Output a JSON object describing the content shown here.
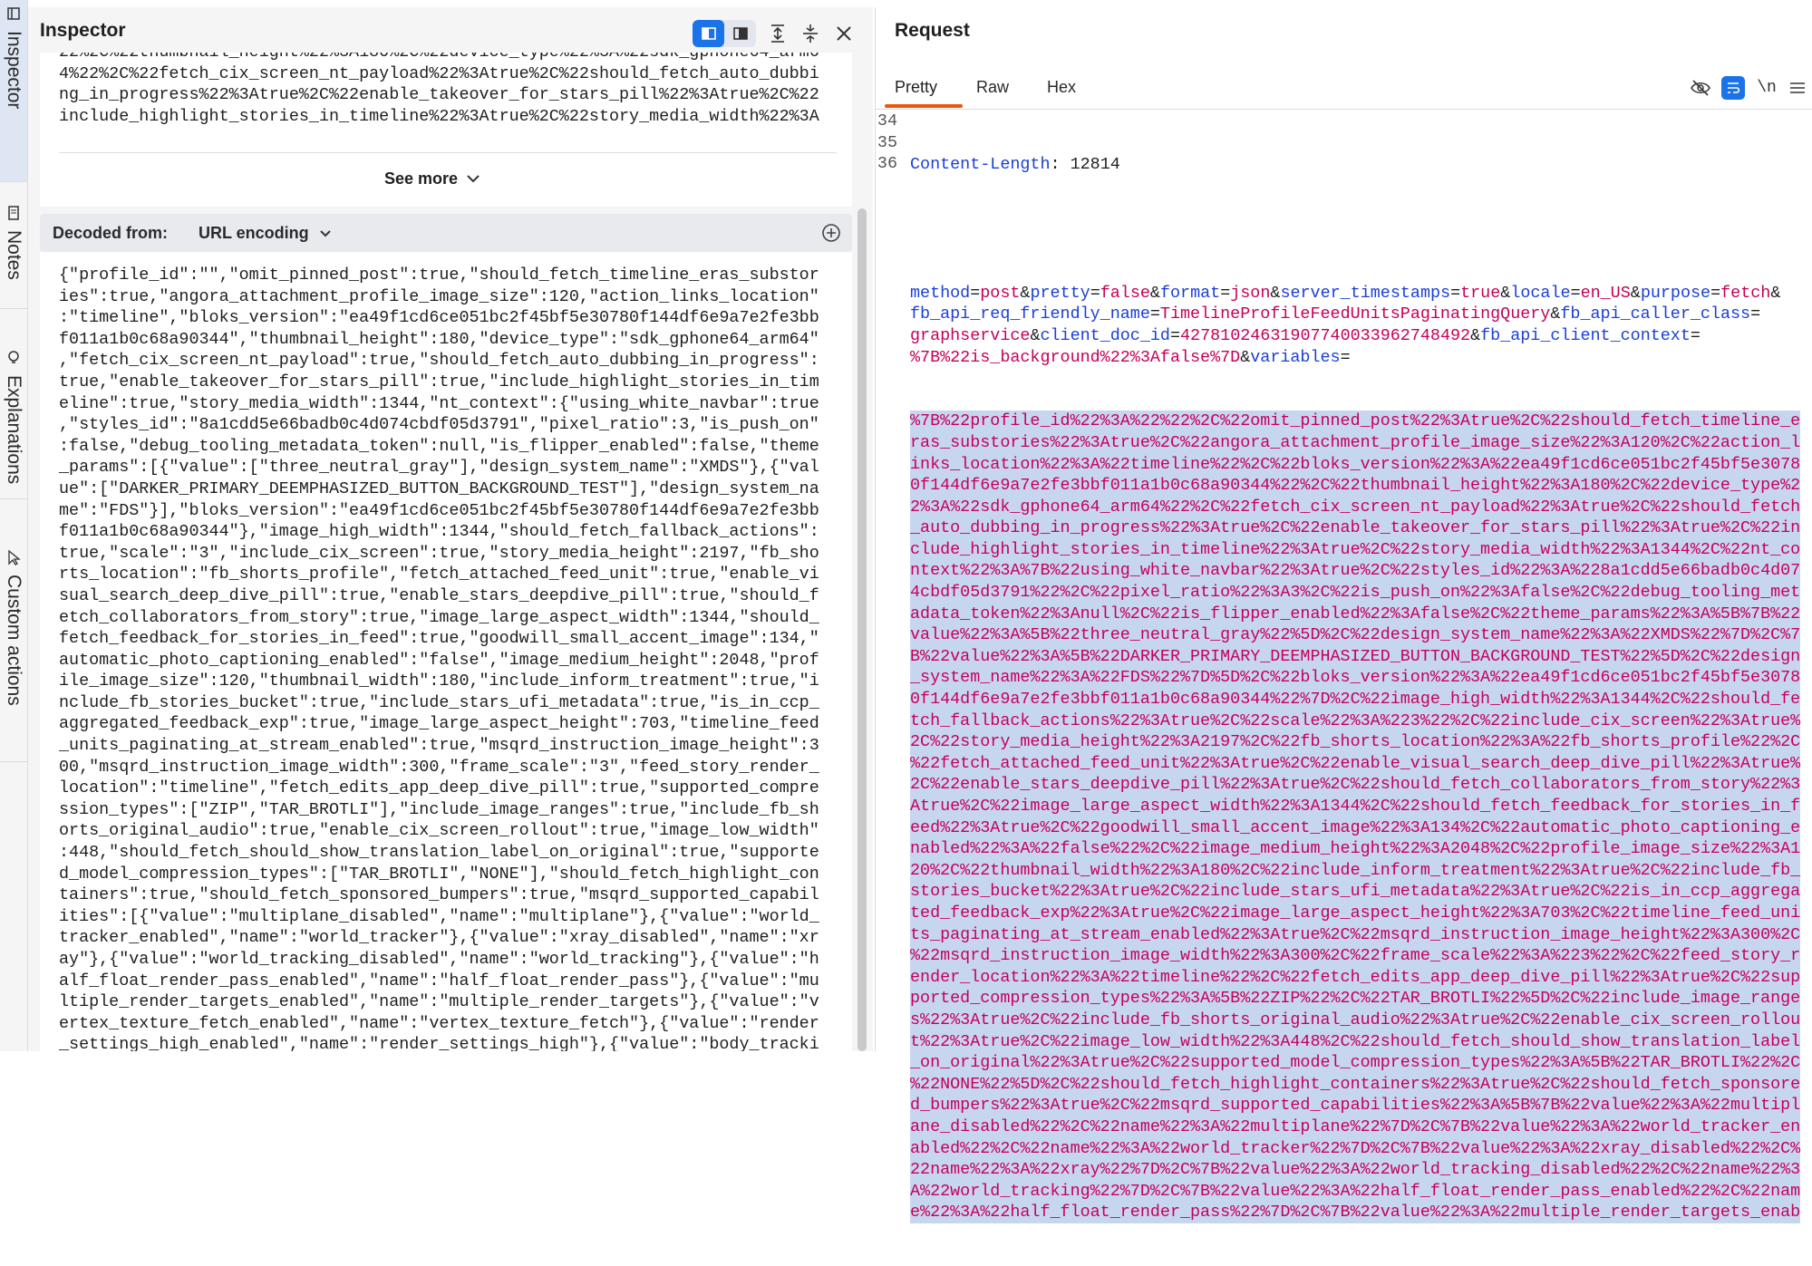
{
  "sidebar": {
    "tabs": [
      {
        "label": "Inspector",
        "icon": "inspector-icon",
        "active": true
      },
      {
        "label": "Notes",
        "icon": "notes-icon",
        "active": false
      },
      {
        "label": "Explanations",
        "icon": "lightbulb-icon",
        "active": false
      },
      {
        "label": "Custom actions",
        "icon": "custom-action-icon",
        "active": false
      }
    ]
  },
  "inspector": {
    "title": "Inspector",
    "raw_lines": [
      "22%2C%22thumbnail_height%22%3A180%2C%22device_type%22%3A%22sdk_gphone64_arm6",
      "4%22%2C%22fetch_cix_screen_nt_payload%22%3Atrue%2C%22should_fetch_auto_dubbi",
      "ng_in_progress%22%3Atrue%2C%22enable_takeover_for_stars_pill%22%3Atrue%2C%22",
      "include_highlight_stories_in_timeline%22%3Atrue%2C%22story_media_width%22%3A"
    ],
    "see_more_label": "See more",
    "decoded_from_label": "Decoded from:",
    "decoded_from_value": "URL encoding",
    "decoded_lines": [
      "{\"profile_id\":\"\",\"omit_pinned_post\":true,\"should_fetch_timeline_eras_substor",
      "ies\":true,\"angora_attachment_profile_image_size\":120,\"action_links_location\"",
      ":\"timeline\",\"bloks_version\":\"ea49f1cd6ce051bc2f45bf5e30780f144df6e9a7e2fe3bb",
      "f011a1b0c68a90344\",\"thumbnail_height\":180,\"device_type\":\"sdk_gphone64_arm64\"",
      ",\"fetch_cix_screen_nt_payload\":true,\"should_fetch_auto_dubbing_in_progress\":",
      "true,\"enable_takeover_for_stars_pill\":true,\"include_highlight_stories_in_tim",
      "eline\":true,\"story_media_width\":1344,\"nt_context\":{\"using_white_navbar\":true",
      ",\"styles_id\":\"8a1cdd5e66badb0c4d074cbdf05d3791\",\"pixel_ratio\":3,\"is_push_on\"",
      ":false,\"debug_tooling_metadata_token\":null,\"is_flipper_enabled\":false,\"theme",
      "_params\":[{\"value\":[\"three_neutral_gray\"],\"design_system_name\":\"XMDS\"},{\"val",
      "ue\":[\"DARKER_PRIMARY_DEEMPHASIZED_BUTTON_BACKGROUND_TEST\"],\"design_system_na",
      "me\":\"FDS\"}],\"bloks_version\":\"ea49f1cd6ce051bc2f45bf5e30780f144df6e9a7e2fe3bb",
      "f011a1b0c68a90344\"},\"image_high_width\":1344,\"should_fetch_fallback_actions\":",
      "true,\"scale\":\"3\",\"include_cix_screen\":true,\"story_media_height\":2197,\"fb_sho",
      "rts_location\":\"fb_shorts_profile\",\"fetch_attached_feed_unit\":true,\"enable_vi",
      "sual_search_deep_dive_pill\":true,\"enable_stars_deepdive_pill\":true,\"should_f",
      "etch_collaborators_from_story\":true,\"image_large_aspect_width\":1344,\"should_",
      "fetch_feedback_for_stories_in_feed\":true,\"goodwill_small_accent_image\":134,\"",
      "automatic_photo_captioning_enabled\":\"false\",\"image_medium_height\":2048,\"prof",
      "ile_image_size\":120,\"thumbnail_width\":180,\"include_inform_treatment\":true,\"i",
      "nclude_fb_stories_bucket\":true,\"include_stars_ufi_metadata\":true,\"is_in_ccp_",
      "aggregated_feedback_exp\":true,\"image_large_aspect_height\":703,\"timeline_feed",
      "_units_paginating_at_stream_enabled\":true,\"msqrd_instruction_image_height\":3",
      "00,\"msqrd_instruction_image_width\":300,\"frame_scale\":\"3\",\"feed_story_render_",
      "location\":\"timeline\",\"fetch_edits_app_deep_dive_pill\":true,\"supported_compre",
      "ssion_types\":[\"ZIP\",\"TAR_BROTLI\"],\"include_image_ranges\":true,\"include_fb_sh",
      "orts_original_audio\":true,\"enable_cix_screen_rollout\":true,\"image_low_width\"",
      ":448,\"should_fetch_should_show_translation_label_on_original\":true,\"supporte",
      "d_model_compression_types\":[\"TAR_BROTLI\",\"NONE\"],\"should_fetch_highlight_con",
      "tainers\":true,\"should_fetch_sponsored_bumpers\":true,\"msqrd_supported_capabil",
      "ities\":[{\"value\":\"multiplane_disabled\",\"name\":\"multiplane\"},{\"value\":\"world_",
      "tracker_enabled\",\"name\":\"world_tracker\"},{\"value\":\"xray_disabled\",\"name\":\"xr",
      "ay\"},{\"value\":\"world_tracking_disabled\",\"name\":\"world_tracking\"},{\"value\":\"h",
      "alf_float_render_pass_enabled\",\"name\":\"half_float_render_pass\"},{\"value\":\"mu",
      "ltiple_render_targets_enabled\",\"name\":\"multiple_render_targets\"},{\"value\":\"v",
      "ertex_texture_fetch_enabled\",\"name\":\"vertex_texture_fetch\"},{\"value\":\"render",
      "_settings_high_enabled\",\"name\":\"render_settings_high\"},{\"value\":\"body_tracki"
    ]
  },
  "request": {
    "title": "Request",
    "tabs": [
      {
        "label": "Pretty",
        "active": true
      },
      {
        "label": "Raw",
        "active": false
      },
      {
        "label": "Hex",
        "active": false
      }
    ],
    "newline_toggle_label": "\\n",
    "line_numbers": [
      "34",
      "35",
      "36"
    ],
    "header_line": {
      "key": "Content-Length",
      "sep": ": ",
      "value": "12814"
    },
    "body_lines": [
      [
        [
          "k",
          "method"
        ],
        [
          "p",
          "="
        ],
        [
          "v",
          "post"
        ],
        [
          "p",
          "&"
        ],
        [
          "k",
          "pretty"
        ],
        [
          "p",
          "="
        ],
        [
          "v",
          "false"
        ],
        [
          "p",
          "&"
        ],
        [
          "k",
          "format"
        ],
        [
          "p",
          "="
        ],
        [
          "v",
          "json"
        ],
        [
          "p",
          "&"
        ],
        [
          "k",
          "server_timestamps"
        ],
        [
          "p",
          "="
        ],
        [
          "v",
          "true"
        ],
        [
          "p",
          "&"
        ],
        [
          "k",
          "locale"
        ],
        [
          "p",
          "="
        ],
        [
          "v",
          "en_US"
        ],
        [
          "p",
          "&"
        ],
        [
          "k",
          "purpose"
        ],
        [
          "p",
          "="
        ],
        [
          "v",
          "fetch"
        ],
        [
          "p",
          "&"
        ]
      ],
      [
        [
          "k",
          "fb_api_req_friendly_name"
        ],
        [
          "p",
          "="
        ],
        [
          "v",
          "TimelineProfileFeedUnitsPaginatingQuery"
        ],
        [
          "p",
          "&"
        ],
        [
          "k",
          "fb_api_caller_class"
        ],
        [
          "p",
          "="
        ]
      ],
      [
        [
          "v",
          "graphservice"
        ],
        [
          "p",
          "&"
        ],
        [
          "k",
          "client_doc_id"
        ],
        [
          "p",
          "="
        ],
        [
          "v",
          "427810246319077400339627484 92"
        ],
        [
          "p",
          "&"
        ],
        [
          "k",
          "fb_api_client_context"
        ],
        [
          "p",
          "="
        ]
      ],
      [
        [
          "v",
          "%7B%22is_background%22%3Afalse%7D"
        ],
        [
          "p",
          "&"
        ],
        [
          "k",
          "variables"
        ],
        [
          "p",
          "="
        ]
      ]
    ],
    "selected_lines": [
      "%7B%22profile_id%22%3A%22%22%2C%22omit_pinned_post%22%3Atrue%2C%22should_fetch_timeline_e",
      "ras_substories%22%3Atrue%2C%22angora_attachment_profile_image_size%22%3A120%2C%22action_l",
      "inks_location%22%3A%22timeline%22%2C%22bloks_version%22%3A%22ea49f1cd6ce051bc2f45bf5e3078",
      "0f144df6e9a7e2fe3bbf011a1b0c68a90344%22%2C%22thumbnail_height%22%3A180%2C%22device_type%2",
      "2%3A%22sdk_gphone64_arm64%22%2C%22fetch_cix_screen_nt_payload%22%3Atrue%2C%22should_fetch",
      "_auto_dubbing_in_progress%22%3Atrue%2C%22enable_takeover_for_stars_pill%22%3Atrue%2C%22in",
      "clude_highlight_stories_in_timeline%22%3Atrue%2C%22story_media_width%22%3A1344%2C%22nt_co",
      "ntext%22%3A%7B%22using_white_navbar%22%3Atrue%2C%22styles_id%22%3A%228a1cdd5e66badb0c4d07",
      "4cbdf05d3791%22%2C%22pixel_ratio%22%3A3%2C%22is_push_on%22%3Afalse%2C%22debug_tooling_met",
      "adata_token%22%3Anull%2C%22is_flipper_enabled%22%3Afalse%2C%22theme_params%22%3A%5B%7B%22",
      "value%22%3A%5B%22three_neutral_gray%22%5D%2C%22design_system_name%22%3A%22XMDS%22%7D%2C%7",
      "B%22value%22%3A%5B%22DARKER_PRIMARY_DEEMPHASIZED_BUTTON_BACKGROUND_TEST%22%5D%2C%22design",
      "_system_name%22%3A%22FDS%22%7D%5D%2C%22bloks_version%22%3A%22ea49f1cd6ce051bc2f45bf5e3078",
      "0f144df6e9a7e2fe3bbf011a1b0c68a90344%22%7D%2C%22image_high_width%22%3A1344%2C%22should_fe",
      "tch_fallback_actions%22%3Atrue%2C%22scale%22%3A%223%22%2C%22include_cix_screen%22%3Atrue%",
      "2C%22story_media_height%22%3A2197%2C%22fb_shorts_location%22%3A%22fb_shorts_profile%22%2C",
      "%22fetch_attached_feed_unit%22%3Atrue%2C%22enable_visual_search_deep_dive_pill%22%3Atrue%",
      "2C%22enable_stars_deepdive_pill%22%3Atrue%2C%22should_fetch_collaborators_from_story%22%3",
      "Atrue%2C%22image_large_aspect_width%22%3A1344%2C%22should_fetch_feedback_for_stories_in_f",
      "eed%22%3Atrue%2C%22goodwill_small_accent_image%22%3A134%2C%22automatic_photo_captioning_e",
      "nabled%22%3A%22false%22%2C%22image_medium_height%22%3A2048%2C%22profile_image_size%22%3A1",
      "20%2C%22thumbnail_width%22%3A180%2C%22include_inform_treatment%22%3Atrue%2C%22include_fb_",
      "stories_bucket%22%3Atrue%2C%22include_stars_ufi_metadata%22%3Atrue%2C%22is_in_ccp_aggrega",
      "ted_feedback_exp%22%3Atrue%2C%22image_large_aspect_height%22%3A703%2C%22timeline_feed_uni",
      "ts_paginating_at_stream_enabled%22%3Atrue%2C%22msqrd_instruction_image_height%22%3A300%2C",
      "%22msqrd_instruction_image_width%22%3A300%2C%22frame_scale%22%3A%223%22%2C%22feed_story_r",
      "ender_location%22%3A%22timeline%22%2C%22fetch_edits_app_deep_dive_pill%22%3Atrue%2C%22sup",
      "ported_compression_types%22%3A%5B%22ZIP%22%2C%22TAR_BROTLI%22%5D%2C%22include_image_range",
      "s%22%3Atrue%2C%22include_fb_shorts_original_audio%22%3Atrue%2C%22enable_cix_screen_rollou",
      "t%22%3Atrue%2C%22image_low_width%22%3A448%2C%22should_fetch_should_show_translation_label",
      "_on_original%22%3Atrue%2C%22supported_model_compression_types%22%3A%5B%22TAR_BROTLI%22%2C",
      "%22NONE%22%5D%2C%22should_fetch_highlight_containers%22%3Atrue%2C%22should_fetch_sponsore",
      "d_bumpers%22%3Atrue%2C%22msqrd_supported_capabilities%22%3A%5B%7B%22value%22%3A%22multipl",
      "ane_disabled%22%2C%22name%22%3A%22multiplane%22%7D%2C%7B%22value%22%3A%22world_tracker_en",
      "abled%22%2C%22name%22%3A%22world_tracker%22%7D%2C%7B%22value%22%3A%22xray_disabled%22%2C%",
      "22name%22%3A%22xray%22%7D%2C%7B%22value%22%3A%22world_tracking_disabled%22%2C%22name%22%3",
      "A%22world_tracking%22%7D%2C%7B%22value%22%3A%22half_float_render_pass_enabled%22%2C%22nam",
      "e%22%3A%22half_float_render_pass%22%7D%2C%7B%22value%22%3A%22multiple_render_targets_enab"
    ]
  },
  "colors": {
    "accent": "#1a73e8",
    "tab_underline": "#e8590c",
    "key_blue": "#1a3fd6",
    "value_magenta": "#c6005a",
    "selection": "#c7d6ef"
  }
}
